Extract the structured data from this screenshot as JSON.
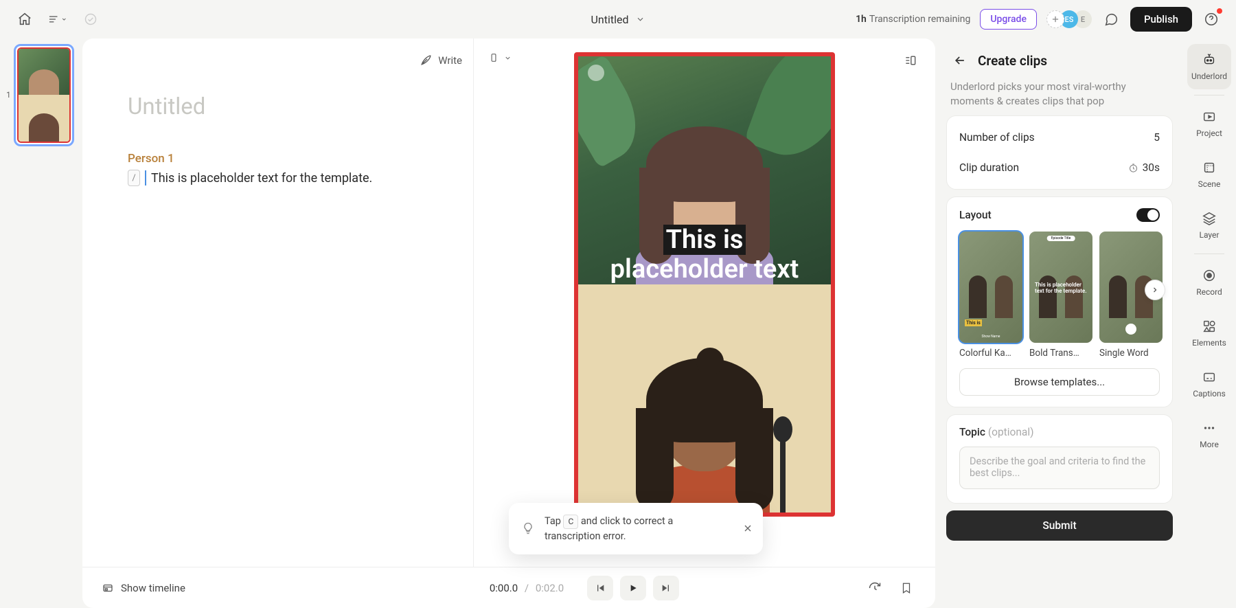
{
  "topbar": {
    "doc_title": "Untitled",
    "transcription_time": "1h",
    "transcription_label": "Transcription remaining",
    "upgrade": "Upgrade",
    "avatar_es": "ES",
    "avatar_e": "E",
    "publish": "Publish"
  },
  "scenes": {
    "current": "1"
  },
  "editor": {
    "write": "Write",
    "title_placeholder": "Untitled",
    "speaker": "Person 1",
    "slash": "/",
    "line": "This is placeholder text for the template.",
    "preview_caption_1": "This is",
    "preview_caption_2": "placeholder text"
  },
  "tooltip": {
    "pre": "Tap ",
    "key": "C",
    "post": " and click to correct a transcription error."
  },
  "playback": {
    "show_timeline": "Show timeline",
    "current": "0:00.0",
    "sep": "/",
    "duration": "0:02.0"
  },
  "panel": {
    "title": "Create clips",
    "desc": "Underlord picks your most viral-worthy moments & creates clips that pop",
    "num_clips_label": "Number of clips",
    "num_clips_val": "5",
    "duration_label": "Clip duration",
    "duration_val": "30s",
    "layout_label": "Layout",
    "layouts": [
      "Colorful Ka…",
      "Bold Trans…",
      "Single Word"
    ],
    "lt1_cap": "This is",
    "lt1_show": "Show Name",
    "lt2_hdr": "Episode Title",
    "lt2_cap": "This is placeholder text for the template.",
    "browse": "Browse templates...",
    "topic_label": "Topic",
    "topic_optional": "(optional)",
    "topic_placeholder": "Describe the goal and criteria to find the best clips...",
    "submit": "Submit"
  },
  "rail": {
    "underlord": "Underlord",
    "project": "Project",
    "scene": "Scene",
    "layer": "Layer",
    "record": "Record",
    "elements": "Elements",
    "captions": "Captions",
    "more": "More"
  }
}
